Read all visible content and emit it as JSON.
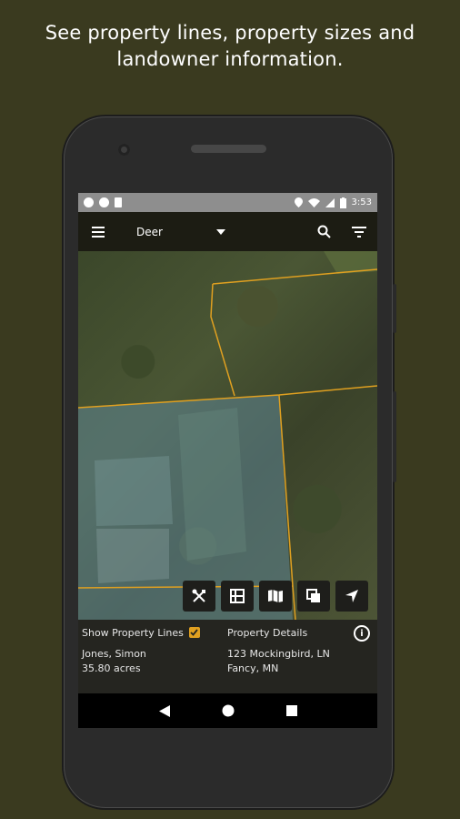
{
  "headline": {
    "line1": "See property lines, property sizes and",
    "line2": "landowner information."
  },
  "status_bar": {
    "time": "3:53",
    "left_icons": [
      "shield-icon",
      "circle-icon",
      "sd-card-icon"
    ],
    "right_icons": [
      "location-icon",
      "wifi-icon",
      "signal-icon",
      "battery-icon"
    ]
  },
  "app_bar": {
    "menu_icon": "hamburger-menu-icon",
    "title": "Deer",
    "dropdown_icon": "caret-down-icon",
    "search_icon": "search-icon",
    "filter_icon": "filter-icon"
  },
  "map_tools": [
    "tools-icon",
    "grid-icon",
    "map-icon",
    "layers-icon",
    "navigate-icon"
  ],
  "property_panel": {
    "show_lines_label": "Show Property Lines",
    "show_lines_checked": true,
    "owner": "Jones, Simon",
    "acres": "35.80 acres",
    "details_label": "Property Details",
    "address_line1": "123 Mockingbird, LN",
    "address_line2": "Fancy, MN",
    "info_icon": "info-icon"
  },
  "nav_bar": [
    "back-icon",
    "home-icon",
    "recents-icon"
  ],
  "colors": {
    "background": "#3a3a1f",
    "property_line": "#e0a020",
    "app_bar": "#1c1c13",
    "panel": "#252520"
  }
}
